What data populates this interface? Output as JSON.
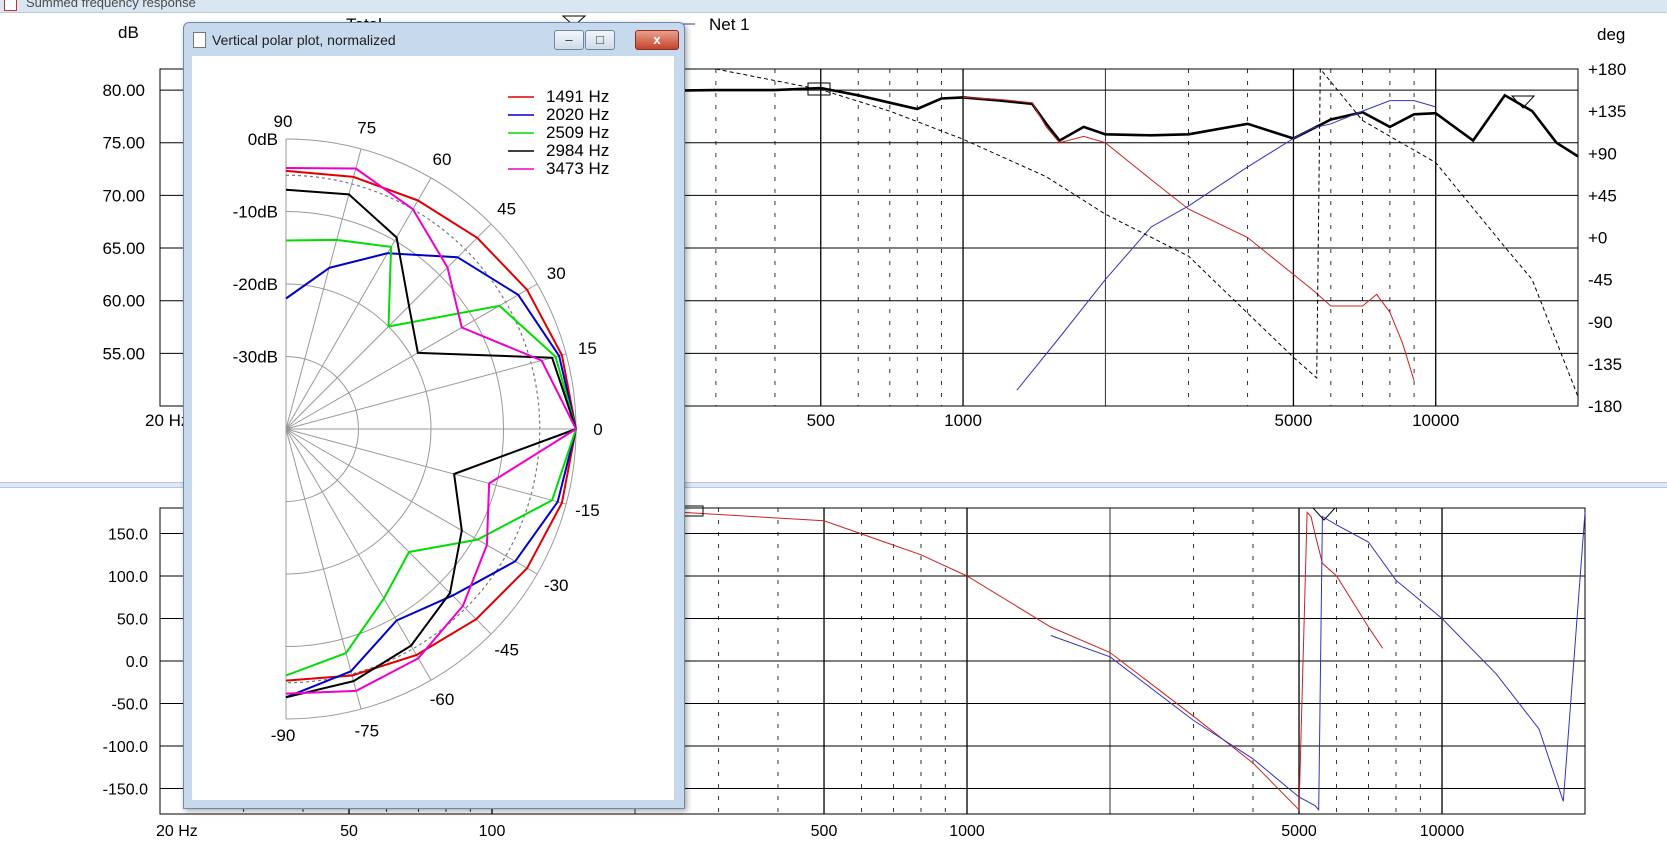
{
  "window": {
    "title": "Summed frequency response"
  },
  "legend_top": {
    "total": "Total",
    "net1": "Net 1"
  },
  "top_plot": {
    "left_unit": "dB",
    "right_unit": "deg",
    "y_ticks": [
      "80.00",
      "75.00",
      "70.00",
      "65.00",
      "60.00",
      "55.00"
    ],
    "phase_ticks": [
      "+180",
      "+135",
      "+90",
      "+45",
      "+0",
      "-45",
      "-90",
      "-135",
      "-180"
    ],
    "x_ticks": [
      "20 Hz",
      "500",
      "1000",
      "5000",
      "10000"
    ]
  },
  "bottom_plot": {
    "y_ticks": [
      "150.0",
      "100.0",
      "50.0",
      "0.0",
      "-50.0",
      "-100.0",
      "-150.0"
    ],
    "x_ticks": [
      "20 Hz",
      "50",
      "100",
      "500",
      "1000",
      "5000",
      "10000"
    ]
  },
  "polar_window": {
    "title": "Vertical polar plot, normalized",
    "controls": {
      "minimize": "–",
      "maximize": "□",
      "close": "x"
    },
    "db_labels": [
      "0dB",
      "-10dB",
      "-20dB",
      "-30dB"
    ],
    "angle_labels": [
      "90",
      "75",
      "60",
      "45",
      "30",
      "15",
      "0",
      "-15",
      "-30",
      "-45",
      "-60",
      "-75",
      "-90"
    ]
  },
  "colors": {
    "red": "#e00000",
    "blue": "#0000cc",
    "green": "#00dd00",
    "black": "#000000",
    "magenta": "#ee00cc",
    "grid": "#000000",
    "window_frame": "#c7d9ec"
  },
  "chart_data": [
    {
      "type": "line",
      "x_scale": "log",
      "xlim": [
        20,
        20000
      ],
      "ylim": [
        50,
        82
      ],
      "y2lim": [
        -180,
        180
      ],
      "series": [
        {
          "name": "Total",
          "color": "black",
          "axis": "dB",
          "x": [
            200,
            300,
            400,
            500,
            600,
            700,
            800,
            900,
            1000,
            1200,
            1400,
            1500,
            1600,
            1800,
            2000,
            2500,
            3000,
            4000,
            5000,
            6000,
            7000,
            8000,
            9000,
            10000,
            12000,
            14000,
            16000,
            18000,
            20000
          ],
          "y": [
            79.9,
            80.0,
            80.0,
            80.2,
            79.5,
            78.8,
            78.2,
            79.2,
            79.3,
            79.0,
            78.7,
            76.8,
            75.2,
            76.5,
            75.8,
            75.7,
            75.8,
            76.8,
            75.4,
            77.2,
            77.9,
            76.5,
            77.7,
            77.8,
            75.2,
            79.5,
            78.0,
            75.0,
            73.7
          ]
        },
        {
          "name": "",
          "color": "#cc2222",
          "axis": "dB",
          "x": [
            1000,
            1200,
            1400,
            1500,
            1600,
            1800,
            2000,
            2500,
            3000,
            4000,
            5000,
            5500,
            6000,
            7000,
            7500,
            8000,
            8500,
            9000
          ],
          "y": [
            79.3,
            79.1,
            78.8,
            76.5,
            75.0,
            75.6,
            75.0,
            71.5,
            68.7,
            66.0,
            62.5,
            61.0,
            59.5,
            59.5,
            60.6,
            58.9,
            56.0,
            52.4
          ]
        },
        {
          "name": "",
          "color": "#3333bb",
          "axis": "dB",
          "x": [
            1300,
            1600,
            2000,
            2500,
            3000,
            4000,
            5000,
            5500,
            6000,
            7000,
            8000,
            9000,
            10000
          ],
          "y": [
            51.5,
            56.5,
            62.0,
            67.0,
            69.0,
            72.7,
            75.4,
            76.4,
            76.8,
            78.0,
            79.0,
            79.0,
            78.4
          ]
        },
        {
          "name": "",
          "color": "black",
          "dash": true,
          "axis": "deg",
          "x": [
            300,
            500,
            700,
            1000,
            1500,
            2000,
            3000,
            5000,
            5600,
            5700,
            7000,
            10000,
            14000,
            16000,
            20000
          ],
          "y": [
            180,
            158,
            135,
            105,
            65,
            25,
            -20,
            -128,
            -150,
            180,
            125,
            80,
            -10,
            -45,
            -170
          ]
        }
      ]
    },
    {
      "type": "line",
      "x_scale": "log",
      "xlim": [
        20,
        20000
      ],
      "ylim": [
        -180,
        180
      ],
      "series": [
        {
          "name": "",
          "color": "#cc2222",
          "x": [
            250,
            500,
            800,
            1000,
            1500,
            2000,
            3000,
            4000,
            5000,
            5200,
            5300,
            5400,
            5600,
            6000,
            7000,
            7500
          ],
          "y": [
            175,
            165,
            125,
            100,
            40,
            10,
            -65,
            -120,
            -175,
            175,
            170,
            150,
            115,
            100,
            40,
            15
          ]
        },
        {
          "name": "",
          "color": "#3333bb",
          "x": [
            1500,
            2000,
            3000,
            4000,
            5000,
            5400,
            5500,
            5600,
            6000,
            7000,
            8000,
            10000,
            13000,
            16000,
            18000,
            20000
          ],
          "y": [
            30,
            5,
            -70,
            -115,
            -160,
            -170,
            -175,
            170,
            160,
            140,
            95,
            50,
            -15,
            -80,
            -165,
            175
          ]
        }
      ]
    },
    {
      "type": "line",
      "subtype": "polar",
      "title": "Vertical polar plot, normalized",
      "r_ticks_db": [
        0,
        -10,
        -20,
        -30
      ],
      "r_range_db": [
        -40,
        0
      ],
      "angle_ticks_deg": [
        90,
        75,
        60,
        45,
        30,
        15,
        0,
        -15,
        -30,
        -45,
        -60,
        -75,
        -90
      ],
      "legend_position": "top-right",
      "series": [
        {
          "name": "1491 Hz",
          "color": "red",
          "angles": [
            0,
            15,
            30,
            45,
            60,
            75,
            90,
            -15,
            -30,
            -45,
            -60,
            -75,
            -90
          ],
          "db": [
            0,
            -0.6,
            -1.6,
            -2.7,
            -3.6,
            -4.0,
            -4.4,
            -0.6,
            -1.6,
            -2.9,
            -4.0,
            -4.8,
            -5.3
          ]
        },
        {
          "name": "2020 Hz",
          "color": "blue",
          "angles": [
            0,
            15,
            30,
            45,
            60,
            75,
            90,
            -15,
            -30,
            -45,
            -60,
            -75,
            -90
          ],
          "db": [
            0,
            -1.0,
            -3.0,
            -6.5,
            -12.0,
            -17.0,
            -22.0,
            -1.2,
            -3.5,
            -7.5,
            -9.5,
            -5.4,
            -3.0
          ]
        },
        {
          "name": "2509 Hz",
          "color": "green",
          "angles": [
            0,
            15,
            30,
            45,
            60,
            75,
            90,
            -15,
            -30,
            -45,
            -60,
            -75,
            -90
          ],
          "db": [
            0,
            -1.5,
            -6.0,
            -20.0,
            -11.0,
            -13.0,
            -14.0,
            -2.0,
            -9.5,
            -16.0,
            -13.0,
            -8.0,
            -6.0
          ]
        },
        {
          "name": "2984 Hz",
          "color": "black",
          "angles": [
            0,
            15,
            30,
            45,
            60,
            75,
            90,
            -15,
            -30,
            -45,
            -60,
            -75,
            -90
          ],
          "db": [
            0,
            -2.0,
            -19.0,
            -16.0,
            -9.5,
            -6.5,
            -7.0,
            -16.0,
            -12.0,
            -8.0,
            -5.5,
            -4.0,
            -3.0
          ]
        },
        {
          "name": "3473 Hz",
          "color": "magenta",
          "angles": [
            0,
            15,
            30,
            45,
            60,
            75,
            90,
            -15,
            -30,
            -45,
            -60,
            -75,
            -90
          ],
          "db": [
            0,
            -3.5,
            -12.0,
            -8.5,
            -5.0,
            -2.8,
            -4.0,
            -11.0,
            -8.0,
            -5.5,
            -3.5,
            -2.6,
            -3.5
          ]
        }
      ]
    }
  ]
}
